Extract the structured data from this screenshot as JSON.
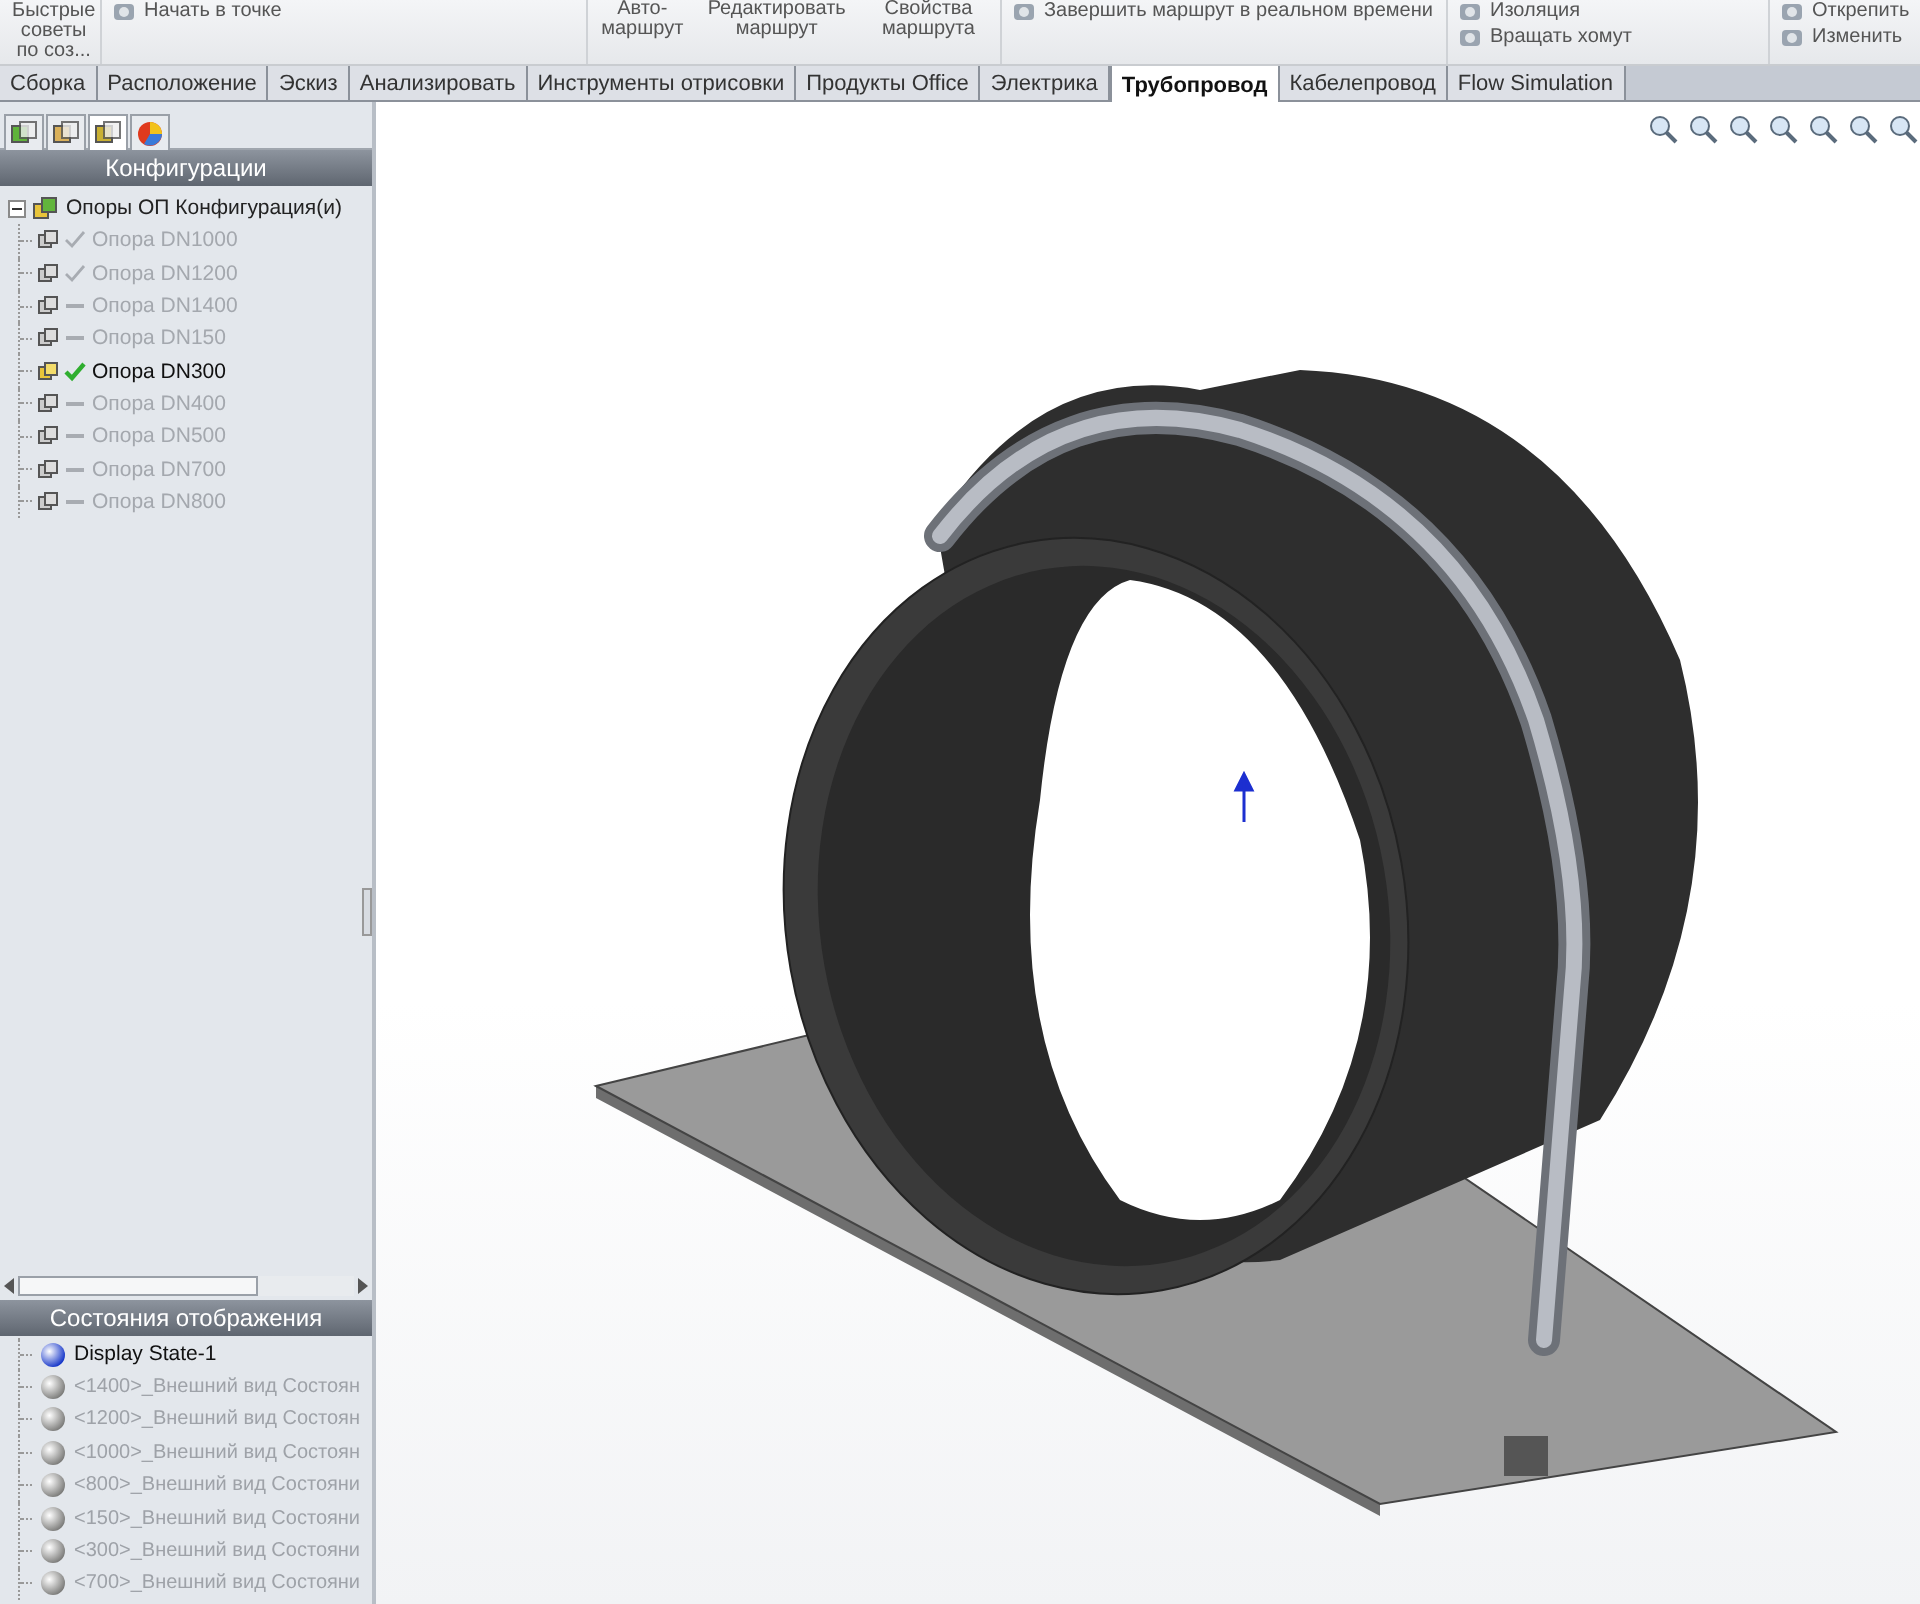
{
  "toolbar": {
    "groups": [
      {
        "kind": "big",
        "labels": [
          "Быстрые советы по соз..."
        ]
      },
      {
        "kind": "small",
        "labels": [
          "Начать в точке"
        ]
      },
      {
        "kind": "big",
        "labels": [
          "Авто-маршрут",
          "Редактировать маршрут",
          "Свойства маршрута"
        ]
      },
      {
        "kind": "small",
        "labels": [
          "Завершить маршрут в реальном времени"
        ]
      },
      {
        "kind": "small",
        "labels": [
          "Изоляция",
          "Вращать хомут"
        ]
      },
      {
        "kind": "small",
        "labels": [
          "Открепить",
          "Изменить"
        ]
      }
    ]
  },
  "tabs": [
    {
      "label": "Сборка",
      "selected": false
    },
    {
      "label": "Расположение",
      "selected": false
    },
    {
      "label": "Эскиз",
      "selected": false
    },
    {
      "label": "Анализировать",
      "selected": false
    },
    {
      "label": "Инструменты отрисовки",
      "selected": false
    },
    {
      "label": "Продукты Office",
      "selected": false
    },
    {
      "label": "Электрика",
      "selected": false
    },
    {
      "label": "Трубопровод",
      "selected": true
    },
    {
      "label": "Кабелепровод",
      "selected": false
    },
    {
      "label": "Flow Simulation",
      "selected": false
    }
  ],
  "panel_tabs": [
    {
      "selected": false
    },
    {
      "selected": false
    },
    {
      "selected": true
    },
    {
      "selected": false
    }
  ],
  "configurations": {
    "title": "Конфигурации",
    "root": {
      "label": "Опоры ОП Конфигурация(и)",
      "expanded": true,
      "children": [
        {
          "label": "Опора DN1000",
          "kind": "check",
          "selected": false
        },
        {
          "label": "Опора DN1200",
          "kind": "check",
          "selected": false
        },
        {
          "label": "Опора DN1400",
          "kind": "dash",
          "selected": false
        },
        {
          "label": "Опора DN150",
          "kind": "dash",
          "selected": false
        },
        {
          "label": "Опора DN300",
          "kind": "check",
          "selected": true
        },
        {
          "label": "Опора DN400",
          "kind": "dash",
          "selected": false
        },
        {
          "label": "Опора DN500",
          "kind": "dash",
          "selected": false
        },
        {
          "label": "Опора DN700",
          "kind": "dash",
          "selected": false
        },
        {
          "label": "Опора DN800",
          "kind": "dash",
          "selected": false
        }
      ]
    }
  },
  "display_states": {
    "title": "Состояния отображения",
    "items": [
      {
        "label": "Display State-1",
        "selected": true
      },
      {
        "label": "<1400>_Внешний вид Состоян",
        "selected": false
      },
      {
        "label": "<1200>_Внешний вид Состоян",
        "selected": false
      },
      {
        "label": "<1000>_Внешний вид Состоян",
        "selected": false
      },
      {
        "label": "<800>_Внешний вид Состояни",
        "selected": false
      },
      {
        "label": "<150>_Внешний вид Состояни",
        "selected": false
      },
      {
        "label": "<300>_Внешний вид Состояни",
        "selected": false
      },
      {
        "label": "<700>_Внешний вид Состояни",
        "selected": false
      }
    ]
  }
}
